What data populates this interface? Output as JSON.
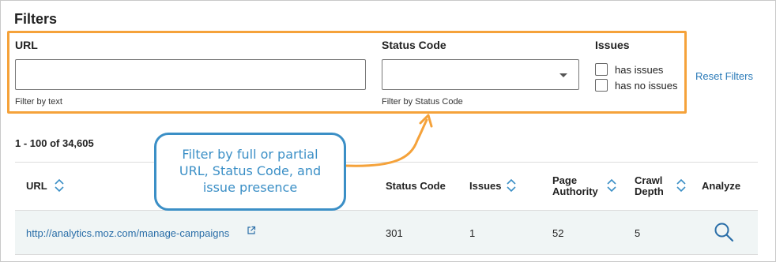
{
  "filters": {
    "title": "Filters",
    "url": {
      "label": "URL",
      "value": "",
      "hint": "Filter by text"
    },
    "status_code": {
      "label": "Status Code",
      "selected": "",
      "hint": "Filter by Status Code"
    },
    "issues": {
      "label": "Issues",
      "options": [
        {
          "label": "has issues",
          "checked": false
        },
        {
          "label": "has no issues",
          "checked": false
        }
      ]
    },
    "reset_label": "Reset Filters"
  },
  "results": {
    "count_text": "1 - 100 of 34,605"
  },
  "table": {
    "headers": {
      "url": "URL",
      "status_code": "Status Code",
      "issues": "Issues",
      "page_authority": [
        "Page",
        "Authority"
      ],
      "crawl_depth": [
        "Crawl",
        "Depth"
      ],
      "analyze": "Analyze"
    },
    "rows": [
      {
        "url": "http://analytics.moz.com/manage-campaigns",
        "status_code": "301",
        "issues": "1",
        "page_authority": "52",
        "crawl_depth": "5"
      }
    ]
  },
  "callout": {
    "text": "Filter by full or partial\nURL, Status Code, and\nissue presence"
  },
  "colors": {
    "highlight_border": "#f5a23a",
    "callout_border": "#3b8fc6",
    "link": "#2a6ea8",
    "row_background": "#f0f5f5"
  },
  "icons": [
    "sort-icon",
    "external-link-icon",
    "search-icon",
    "chevron-down-icon"
  ]
}
